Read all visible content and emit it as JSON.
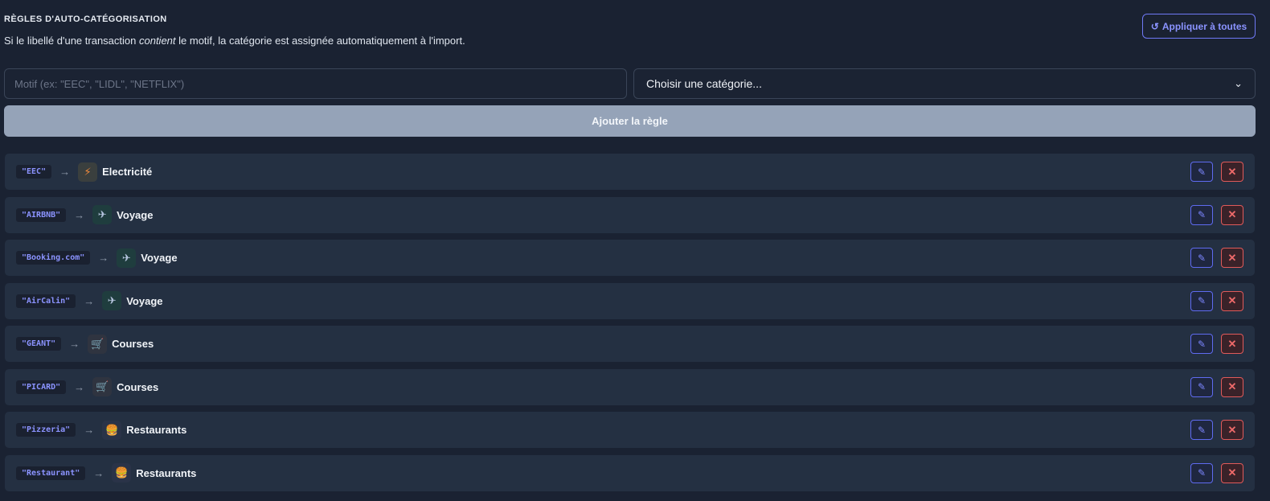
{
  "header": {
    "title": "Règles d'auto-catégorisation",
    "subtitle_before": "Si le libellé d'une transaction ",
    "subtitle_em": "contient",
    "subtitle_after": " le motif, la catégorie est assignée automatiquement à l'import.",
    "apply_icon": "↺",
    "apply_label": "Appliquer à toutes"
  },
  "form": {
    "motif_placeholder": "Motif (ex: \"EEC\", \"LIDL\", \"NETFLIX\")",
    "motif_value": "",
    "category_selected": "Choisir une catégorie...",
    "add_label": "Ajouter la règle"
  },
  "rules": [
    {
      "pattern": "\"EEC\"",
      "arrow": "→",
      "icon": "⚡",
      "icon_name": "lightning-icon",
      "kind": "elec",
      "category": "Electricité"
    },
    {
      "pattern": "\"AIRBNB\"",
      "arrow": "→",
      "icon": "✈",
      "icon_name": "airplane-icon",
      "kind": "voy",
      "category": "Voyage"
    },
    {
      "pattern": "\"Booking.com\"",
      "arrow": "→",
      "icon": "✈",
      "icon_name": "airplane-icon",
      "kind": "voy",
      "category": "Voyage"
    },
    {
      "pattern": "\"AirCalin\"",
      "arrow": "→",
      "icon": "✈",
      "icon_name": "airplane-icon",
      "kind": "voy",
      "category": "Voyage"
    },
    {
      "pattern": "\"GEANT\"",
      "arrow": "→",
      "icon": "🛒",
      "icon_name": "cart-icon",
      "kind": "cour",
      "category": "Courses"
    },
    {
      "pattern": "\"PICARD\"",
      "arrow": "→",
      "icon": "🛒",
      "icon_name": "cart-icon",
      "kind": "cour",
      "category": "Courses"
    },
    {
      "pattern": "\"Pizzeria\"",
      "arrow": "→",
      "icon": "🍔",
      "icon_name": "burger-icon",
      "kind": "rest",
      "category": "Restaurants"
    },
    {
      "pattern": "\"Restaurant\"",
      "arrow": "→",
      "icon": "🍔",
      "icon_name": "burger-icon",
      "kind": "rest",
      "category": "Restaurants"
    }
  ],
  "colors": {
    "background": "#1a2232",
    "row": "#243042",
    "accent": "#6f79f5",
    "danger": "#e05a5a",
    "add_button": "#95a3b8"
  }
}
